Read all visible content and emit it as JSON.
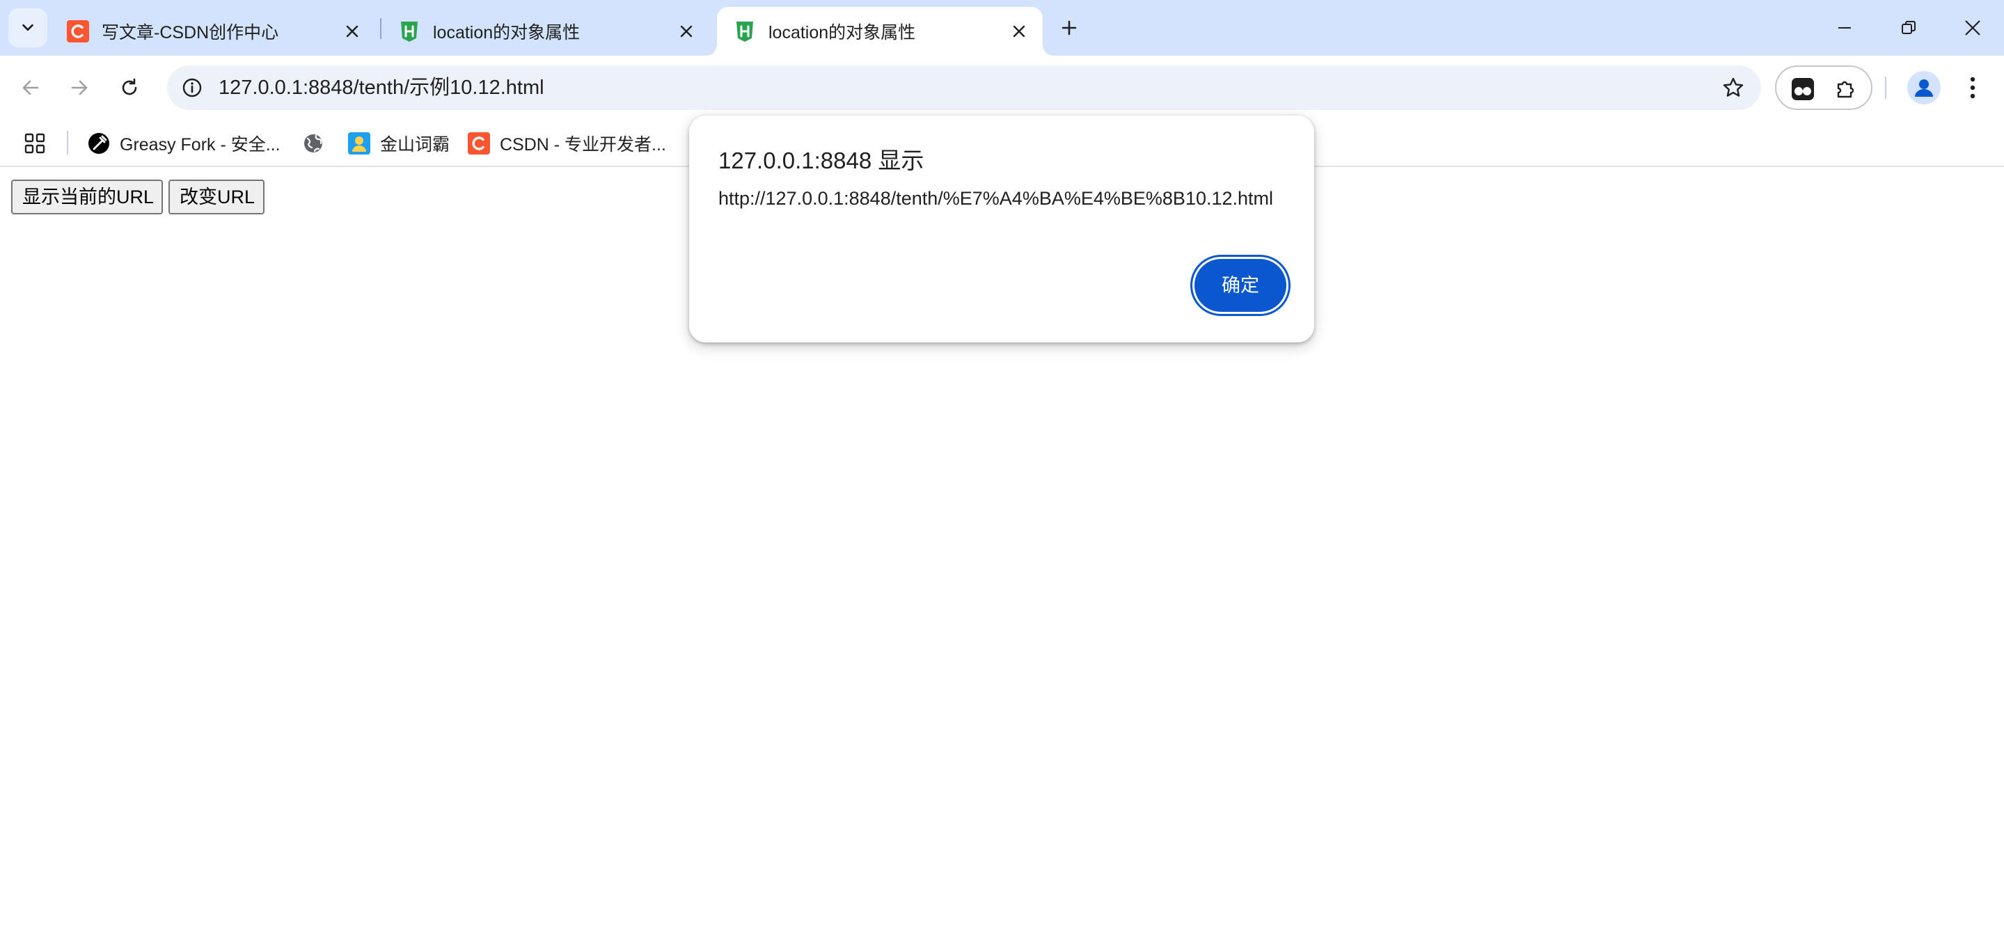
{
  "colors": {
    "tabstrip_bg": "#d3e3fd",
    "omnibox_bg": "#edf2fa",
    "dialog_button": "#0b57d0",
    "csdn_red": "#fc5531",
    "hbuilder_green": "#2aa44f"
  },
  "tabs": [
    {
      "title": "写文章-CSDN创作中心",
      "icon": "csdn-icon",
      "active": false
    },
    {
      "title": "location的对象属性",
      "icon": "hbuilder-icon",
      "active": false
    },
    {
      "title": "location的对象属性",
      "icon": "hbuilder-icon",
      "active": true
    }
  ],
  "toolbar": {
    "url": "127.0.0.1:8848/tenth/示例10.12.html"
  },
  "bookmarks": [
    {
      "label": "Greasy Fork - 安全...",
      "icon": "greasyfork-icon"
    },
    {
      "label": "",
      "icon": "globe-icon"
    },
    {
      "label": "金山词霸",
      "icon": "iciba-icon"
    },
    {
      "label": "CSDN - 专业开发者...",
      "icon": "csdn-icon"
    }
  ],
  "page": {
    "buttons": [
      {
        "label": "显示当前的URL"
      },
      {
        "label": "改变URL"
      }
    ]
  },
  "dialog": {
    "title": "127.0.0.1:8848 显示",
    "message": "http://127.0.0.1:8848/tenth/%E7%A4%BA%E4%BE%8B10.12.html",
    "ok_label": "确定"
  }
}
